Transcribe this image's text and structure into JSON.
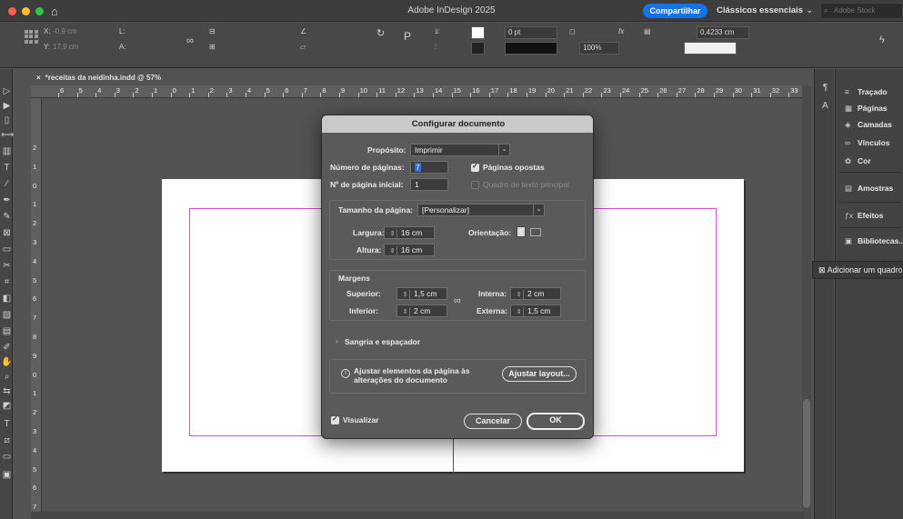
{
  "app": {
    "title": "Adobe InDesign 2025",
    "share_label": "Compartilhar",
    "workspace_label": "Clássicos essenciais",
    "stock_placeholder": "Adobe Stock",
    "colors": {
      "close": "#ff5f57",
      "minimize": "#febc2e",
      "zoom": "#28c840",
      "accent": "#1473e6",
      "margin_guide": "#d44bd4"
    }
  },
  "control_panel": {
    "x_label": "X:",
    "x_value": "-0,9 cm",
    "y_label": "Y:",
    "y_value": "17,9 cm",
    "w_label": "L:",
    "h_label": "A:",
    "stroke_weight": "0 pt",
    "zoom_value": "100%",
    "size_value": "0,4233 cm"
  },
  "document": {
    "tab_label": "*receitas da neidinha.indd @ 57%",
    "ruler_h": [
      "6",
      "5",
      "4",
      "3",
      "2",
      "1",
      "0",
      "1",
      "2",
      "3",
      "4",
      "5",
      "6",
      "7",
      "8",
      "9",
      "10",
      "11",
      "12",
      "13",
      "14",
      "15",
      "16",
      "17",
      "18",
      "19",
      "20",
      "21",
      "22",
      "23",
      "24",
      "25",
      "26",
      "27",
      "28",
      "29",
      "30",
      "31",
      "32",
      "33",
      "34"
    ],
    "ruler_v": [
      "2",
      "1",
      "0",
      "1",
      "2",
      "3",
      "4",
      "5",
      "6",
      "7",
      "8",
      "9",
      "0",
      "1",
      "2",
      "3",
      "4",
      "5",
      "6",
      "7"
    ]
  },
  "panels": {
    "items": [
      {
        "label": "Traçado",
        "icon": "≡"
      },
      {
        "label": "Páginas",
        "icon": "▦"
      },
      {
        "label": "Camadas",
        "icon": "◈"
      },
      {
        "label": "Vínculos",
        "icon": "∞"
      },
      {
        "label": "Cor",
        "icon": "✿"
      },
      {
        "label": "Amostras",
        "icon": "▤"
      },
      {
        "label": "Efeitos",
        "icon": "ƒx"
      },
      {
        "label": "Bibliotecas...",
        "icon": "▣"
      }
    ],
    "frame_tooltip": "Adicionar um quadro"
  },
  "dialog": {
    "title": "Configurar documento",
    "purpose_label": "Propósito:",
    "purpose_value": "Imprimir",
    "num_pages_label": "Número de páginas:",
    "num_pages_value": "7",
    "facing_pages_label": "Páginas opostas",
    "start_page_label": "Nº de página inicial:",
    "start_page_value": "1",
    "primary_text_frame_label": "Quadro de texto principal",
    "page_size_label": "Tamanho da página:",
    "page_size_value": "[Personalizar]",
    "width_label": "Largura:",
    "width_value": "16 cm",
    "height_label": "Altura:",
    "height_value": "16 cm",
    "orientation_label": "Orientação:",
    "margins_label": "Margens",
    "top_label": "Superior:",
    "top_value": "1,5 cm",
    "bottom_label": "Inferior:",
    "bottom_value": "2 cm",
    "inside_label": "Interna:",
    "inside_value": "2 cm",
    "outside_label": "Externa:",
    "outside_value": "1,5 cm",
    "bleed_label": "Sangria e espaçador",
    "adjust_text": "Ajustar elementos da página às alterações do documento",
    "adjust_button": "Ajustar layout...",
    "preview_label": "Visualizar",
    "cancel_button": "Cancelar",
    "ok_button": "OK"
  }
}
